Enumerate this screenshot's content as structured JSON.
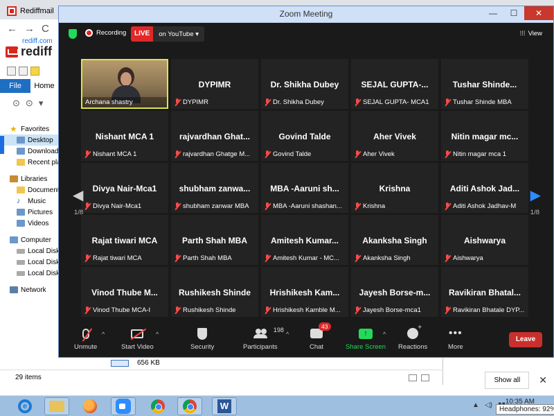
{
  "browser": {
    "tab_title": "Rediffmail",
    "url": "rediff.com",
    "brand": "rediff",
    "nav_back": "←",
    "nav_forward": "→",
    "nav_reload": "C"
  },
  "explorer": {
    "tab_file": "File",
    "tab_home": "Home",
    "tree": {
      "favorites": "Favorites",
      "desktop": "Desktop",
      "downloads": "Downloads",
      "recent": "Recent places",
      "libraries": "Libraries",
      "documents": "Documents",
      "music": "Music",
      "pictures": "Pictures",
      "videos": "Videos",
      "computer": "Computer",
      "local_disk_1": "Local Disk",
      "local_disk_2": "Local Disk",
      "local_disk_3": "Local Disk",
      "network": "Network"
    },
    "item_count": "29 items",
    "file_size": "656 KB"
  },
  "download_bar": {
    "show_all": "Show all",
    "close": "✕"
  },
  "zoom": {
    "title": "Zoom Meeting",
    "controls": {
      "minimize": "—",
      "maximize": "☐",
      "close": "✕"
    },
    "topbar": {
      "recording": "Recording",
      "live_badge": "LIVE",
      "live_target": "on YouTube",
      "view": "View"
    },
    "page_left": "1/8",
    "page_right": "1/8",
    "tiles": [
      {
        "big": "",
        "small": "Archana shastry",
        "video": true,
        "active": true
      },
      {
        "big": "DYPIMR",
        "small": "DYPIMR"
      },
      {
        "big": "Dr. Shikha Dubey",
        "small": "Dr. Shikha Dubey"
      },
      {
        "big": "SEJAL GUPTA-...",
        "small": "SEJAL GUPTA- MCA1"
      },
      {
        "big": "Tushar Shinde...",
        "small": "Tushar Shinde MBA"
      },
      {
        "big": "Nishant  MCA 1",
        "small": "Nishant  MCA 1"
      },
      {
        "big": "rajvardhan Ghat...",
        "small": "rajvardhan Ghatge M..."
      },
      {
        "big": "Govind Talde",
        "small": "Govind Talde"
      },
      {
        "big": "Aher Vivek",
        "small": "Aher Vivek"
      },
      {
        "big": "Nitin magar mc...",
        "small": "Nitin magar mca 1"
      },
      {
        "big": "Divya Nair-Mca1",
        "small": "Divya Nair-Mca1"
      },
      {
        "big": "shubham  zanwa...",
        "small": "shubham zanwar MBA"
      },
      {
        "big": "MBA -Aaruni sh...",
        "small": "MBA -Aaruni shashan..."
      },
      {
        "big": "Krishna",
        "small": "Krishna"
      },
      {
        "big": "Aditi Ashok Jad...",
        "small": "Aditi Ashok Jadhav-M"
      },
      {
        "big": "Rajat tiwari MCA",
        "small": "Rajat tiwari MCA"
      },
      {
        "big": "Parth Shah MBA",
        "small": "Parth Shah MBA"
      },
      {
        "big": "Amitesh Kumar...",
        "small": "Amitesh Kumar - MC..."
      },
      {
        "big": "Akanksha Singh",
        "small": "Akanksha Singh"
      },
      {
        "big": "Aishwarya",
        "small": "Aishwarya"
      },
      {
        "big": "Vinod Thube M...",
        "small": "Vinod Thube MCA-I"
      },
      {
        "big": "Rushikesh Shinde",
        "small": "Rushikesh Shinde"
      },
      {
        "big": "Hrishikesh  Kam...",
        "small": "Hrishikesh Kamble M..."
      },
      {
        "big": "Jayesh Borse-m...",
        "small": "Jayesh Borse-mca1"
      },
      {
        "big": "Ravikiran  Bhatal...",
        "small": "Ravikiran Bhatale DYP..."
      }
    ],
    "toolbar": {
      "unmute": "Unmute",
      "start_video": "Start Video",
      "security": "Security",
      "participants": "Participants",
      "participants_count": "198",
      "chat": "Chat",
      "chat_badge": "43",
      "share_screen": "Share Screen",
      "reactions": "Reactions",
      "more": "More",
      "leave": "Leave"
    }
  },
  "taskbar": {
    "word_label": "W",
    "ie_label": "e",
    "time": "10:35 AM",
    "tooltip": "Headphones: 92%"
  },
  "colors": {
    "zoom_bg": "#1a1a1a",
    "tile_bg": "#232323",
    "live_red": "#e02828",
    "leave_red": "#c9302c",
    "share_green": "#23d959",
    "active_border": "#d7e84b",
    "next_arrow": "#2d8cff"
  }
}
